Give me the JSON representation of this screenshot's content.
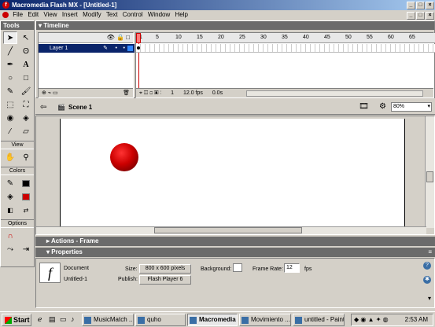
{
  "window": {
    "title": "Macromedia Flash MX - [Untitled-1]"
  },
  "menu": [
    "File",
    "Edit",
    "View",
    "Insert",
    "Modify",
    "Text",
    "Control",
    "Window",
    "Help"
  ],
  "tools": {
    "header": "Tools",
    "view_label": "View",
    "colors_label": "Colors",
    "options_label": "Options"
  },
  "timeline": {
    "header": "Timeline",
    "ruler": [
      "1",
      "5",
      "10",
      "15",
      "20",
      "25",
      "30",
      "35",
      "40",
      "45",
      "50",
      "55",
      "60",
      "65"
    ],
    "layer_name": "Layer 1",
    "current_frame": "1",
    "frame_rate": "12.0 fps",
    "elapsed": "0.0s"
  },
  "editbar": {
    "scene": "Scene 1",
    "zoom": "80%"
  },
  "panels": {
    "actions": "Actions - Frame",
    "properties": "Properties"
  },
  "properties": {
    "type_label": "Document",
    "doc_name": "Untitled-1",
    "size_label": "Size:",
    "size_value": "800 x 600 pixels",
    "publish_label": "Publish:",
    "publish_value": "Flash Player 6",
    "background_label": "Background:",
    "framerate_label": "Frame Rate:",
    "framerate_value": "12",
    "fps_unit": "fps"
  },
  "taskbar": {
    "start": "Start",
    "tasks": [
      "MusicMatch ...",
      "quho",
      "Macromedia ...",
      "Movimiento ...",
      "untitled - Paint"
    ],
    "clock": "2:53 AM"
  },
  "colors": {
    "title_start": "#0a246a",
    "title_end": "#a6caf0",
    "ball": "#cc0000",
    "playhead": "#ff7b7b"
  }
}
